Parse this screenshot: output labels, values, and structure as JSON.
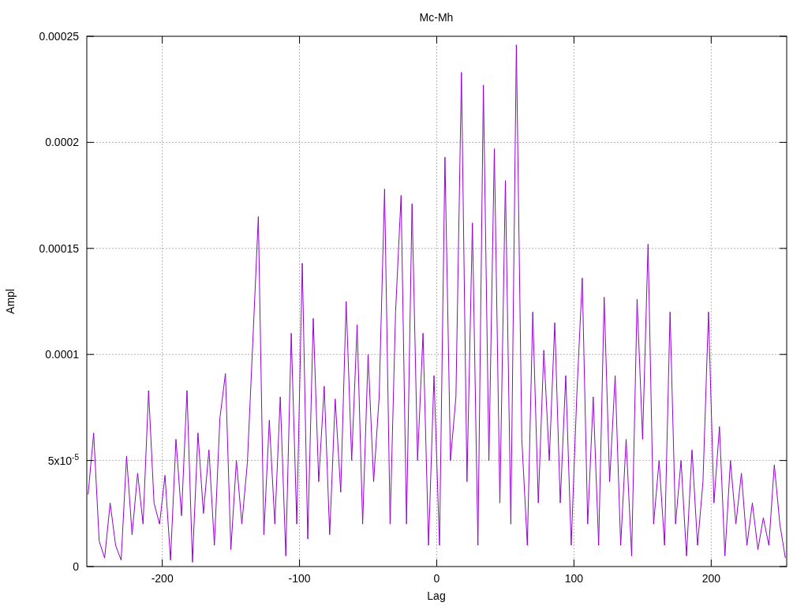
{
  "chart_data": {
    "type": "line",
    "title": "Mc-Mh",
    "xlabel": "Lag",
    "ylabel": "Ampl",
    "grid": true,
    "xlim": [
      -255,
      255
    ],
    "ylim": [
      0,
      0.00025
    ],
    "xticks": [
      -200,
      -100,
      0,
      100,
      200
    ],
    "yticks": [
      {
        "value": 0,
        "label": "0"
      },
      {
        "value": 5e-05,
        "label": "5x10$^{-5}$"
      },
      {
        "value": 0.0001,
        "label": "0.0001"
      },
      {
        "value": 0.00015,
        "label": "0.00015"
      },
      {
        "value": 0.0002,
        "label": "0.0002"
      },
      {
        "value": 0.00025,
        "label": "0.00025"
      }
    ],
    "x": [
      -254,
      -250,
      -246,
      -242,
      -238,
      -234,
      -230,
      -226,
      -222,
      -218,
      -214,
      -210,
      -206,
      -202,
      -198,
      -194,
      -190,
      -186,
      -182,
      -178,
      -174,
      -170,
      -166,
      -162,
      -158,
      -154,
      -150,
      -146,
      -142,
      -138,
      -134,
      -130,
      -126,
      -122,
      -118,
      -114,
      -110,
      -106,
      -102,
      -98,
      -94,
      -90,
      -86,
      -82,
      -78,
      -74,
      -70,
      -66,
      -62,
      -58,
      -54,
      -50,
      -46,
      -42,
      -38,
      -34,
      -30,
      -26,
      -22,
      -18,
      -14,
      -10,
      -6,
      -2,
      2,
      6,
      10,
      14,
      18,
      22,
      26,
      30,
      34,
      38,
      42,
      46,
      50,
      54,
      58,
      62,
      66,
      70,
      74,
      78,
      82,
      86,
      90,
      94,
      98,
      102,
      106,
      110,
      114,
      118,
      122,
      126,
      130,
      134,
      138,
      142,
      146,
      150,
      154,
      158,
      162,
      166,
      170,
      174,
      178,
      182,
      186,
      190,
      194,
      198,
      202,
      206,
      210,
      214,
      218,
      222,
      226,
      230,
      234,
      238,
      242,
      246,
      250,
      254
    ],
    "series": [
      {
        "color": "#9400d3",
        "values": [
          3.4e-05,
          6.3e-05,
          1.2e-05,
          4e-06,
          3e-05,
          1e-05,
          3e-06,
          5.2e-05,
          1.5e-05,
          4.4e-05,
          2e-05,
          8.3e-05,
          3e-05,
          2e-05,
          4.3e-05,
          3e-06,
          6e-05,
          2.4e-05,
          8.3e-05,
          2e-06,
          6.3e-05,
          2.5e-05,
          5.5e-05,
          1e-05,
          7e-05,
          9.1e-05,
          8e-06,
          5e-05,
          2e-05,
          4.9e-05,
          0.000106,
          0.000165,
          1.5e-05,
          6.9e-05,
          2e-05,
          8e-05,
          5e-06,
          0.00011,
          2e-05,
          0.000143,
          1.3e-05,
          0.000117,
          4e-05,
          8.5e-05,
          1.5e-05,
          7.9e-05,
          3.5e-05,
          0.000125,
          5e-05,
          0.000114,
          2e-05,
          0.0001,
          4e-05,
          8e-05,
          0.000178,
          2e-05,
          0.00012,
          0.000175,
          2e-05,
          0.000171,
          5e-05,
          0.00011,
          1e-05,
          9e-05,
          1e-05,
          0.000193,
          5e-05,
          8e-05,
          0.000233,
          4e-05,
          0.000162,
          1e-05,
          0.000227,
          5e-05,
          0.000197,
          3e-05,
          0.000182,
          2e-05,
          0.000246,
          6e-05,
          1e-05,
          0.00012,
          3e-05,
          0.000102,
          5e-05,
          0.000115,
          3e-05,
          9e-05,
          1e-05,
          8e-05,
          0.000136,
          2e-05,
          8e-05,
          1e-05,
          0.000127,
          4e-05,
          9e-05,
          1e-05,
          6e-05,
          5e-06,
          0.000126,
          6e-05,
          0.000152,
          2e-05,
          5e-05,
          1e-05,
          0.00012,
          2e-05,
          5e-05,
          5e-06,
          5.5e-05,
          1e-05,
          4e-05,
          0.00012,
          3e-05,
          6.6e-05,
          5e-06,
          5e-05,
          2e-05,
          4.4e-05,
          1e-05,
          3e-05,
          8e-06,
          2.3e-05,
          1e-05,
          4.8e-05,
          2e-05,
          4e-06
        ]
      }
    ]
  }
}
